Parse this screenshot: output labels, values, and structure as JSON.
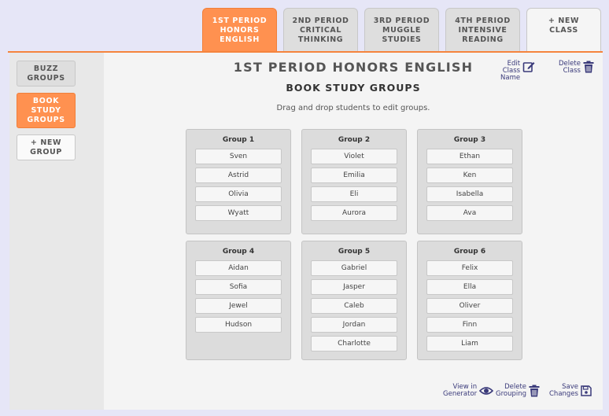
{
  "tabs": [
    {
      "label": "1ST PERIOD\nHONORS\nENGLISH",
      "active": true
    },
    {
      "label": "2ND PERIOD\nCRITICAL\nTHINKING",
      "active": false
    },
    {
      "label": "3RD PERIOD\nMUGGLE\nSTUDIES",
      "active": false
    },
    {
      "label": "4TH PERIOD\nINTENSIVE\nREADING",
      "active": false
    }
  ],
  "new_class_label": "+ NEW\nCLASS",
  "sidebar": {
    "items": [
      {
        "label": "BUZZ\nGROUPS",
        "active": false
      },
      {
        "label": "BOOK\nSTUDY\nGROUPS",
        "active": true
      }
    ],
    "new_group_label": "+ NEW\nGROUP"
  },
  "header": {
    "class_title": "1ST PERIOD HONORS ENGLISH",
    "grouping_title": "BOOK STUDY GROUPS",
    "instructions": "Drag and drop students to edit groups.",
    "edit_class_label": "Edit\nClass\nName",
    "delete_class_label": "Delete\nClass"
  },
  "groups": [
    {
      "title": "Group 1",
      "students": [
        "Sven",
        "Astrid",
        "Olivia",
        "Wyatt"
      ]
    },
    {
      "title": "Group 2",
      "students": [
        "Violet",
        "Emilia",
        "Eli",
        "Aurora"
      ]
    },
    {
      "title": "Group 3",
      "students": [
        "Ethan",
        "Ken",
        "Isabella",
        "Ava"
      ]
    },
    {
      "title": "Group 4",
      "students": [
        "Aidan",
        "Sofia",
        "Jewel",
        "Hudson"
      ]
    },
    {
      "title": "Group 5",
      "students": [
        "Gabriel",
        "Jasper",
        "Caleb",
        "Jordan",
        "Charlotte"
      ]
    },
    {
      "title": "Group 6",
      "students": [
        "Felix",
        "Ella",
        "Oliver",
        "Finn",
        "Liam"
      ]
    }
  ],
  "footer": {
    "view_generator_label": "View in\nGenerator",
    "delete_grouping_label": "Delete\nGrouping",
    "save_changes_label": "Save\nChanges"
  },
  "icons": {
    "edit": "edit-icon",
    "trash": "trash-icon",
    "eye": "eye-icon",
    "save": "floppy-disk-icon"
  },
  "colors": {
    "accent": "#ff9150",
    "link": "#3a3a7a",
    "background": "#e6e6f7"
  }
}
